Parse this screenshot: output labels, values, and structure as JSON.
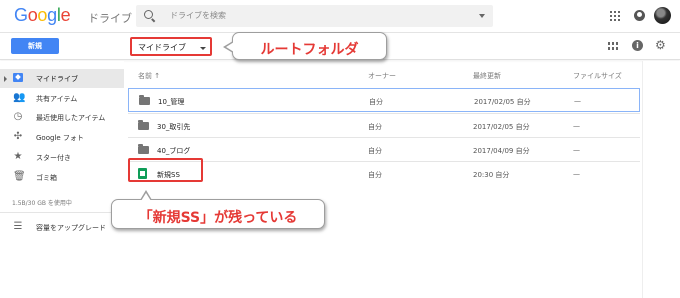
{
  "colors": {
    "accent": "#4285f4",
    "highlight_red": "#e53935",
    "sheets_green": "#0f9d58"
  },
  "header": {
    "logo_letters": [
      {
        "ch": "G",
        "color": "#4285f4"
      },
      {
        "ch": "o",
        "color": "#ea4335"
      },
      {
        "ch": "o",
        "color": "#fbbc05"
      },
      {
        "ch": "g",
        "color": "#4285f4"
      },
      {
        "ch": "l",
        "color": "#34a853"
      },
      {
        "ch": "e",
        "color": "#ea4335"
      }
    ],
    "product": "ドライブ",
    "search_placeholder": "ドライブを検索",
    "icons": [
      "apps-icon",
      "notifications-icon",
      "avatar"
    ]
  },
  "toolbar": {
    "new_label": "新規",
    "breadcrumb": "マイドライブ",
    "icons": [
      "grid-view-icon",
      "info-icon",
      "settings-icon"
    ]
  },
  "sidebar": {
    "items": [
      {
        "label": "マイドライブ",
        "icon": "drive-icon",
        "active": true
      },
      {
        "label": "共有アイテム",
        "icon": "people-icon"
      },
      {
        "label": "最近使用したアイテム",
        "icon": "clock-icon"
      },
      {
        "label": "Google フォト",
        "icon": "photos-icon"
      },
      {
        "label": "スター付き",
        "icon": "star-icon"
      },
      {
        "label": "ゴミ箱",
        "icon": "trash-icon"
      }
    ],
    "quota": "1.5B/30 GB を使用中",
    "upgrade_label": "容量をアップグレード"
  },
  "list": {
    "columns": {
      "name": "名前 ↑",
      "owner": "オーナー",
      "modified": "最終更新",
      "size": "ファイルサイズ"
    },
    "rows": [
      {
        "name": "10_管理",
        "type": "folder",
        "owner": "自分",
        "modified": "2017/02/05 自分",
        "size": "—",
        "selected": true
      },
      {
        "name": "30_取引先",
        "type": "folder",
        "owner": "自分",
        "modified": "2017/02/05 自分",
        "size": "—"
      },
      {
        "name": "40_ブログ",
        "type": "folder",
        "owner": "自分",
        "modified": "2017/04/09 自分",
        "size": "—"
      },
      {
        "name": "新規SS",
        "type": "spreadsheet",
        "owner": "自分",
        "modified": "20:30 自分",
        "size": "—"
      }
    ]
  },
  "annotations": {
    "root_folder": "ルートフォルダ",
    "new_ss_remains": "「新規SS」が残っている"
  }
}
